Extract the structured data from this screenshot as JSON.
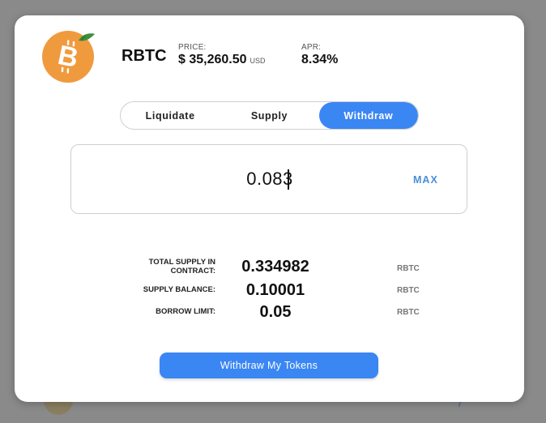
{
  "asset": {
    "symbol": "RBTC",
    "price_label": "PRICE:",
    "price_value": "$ 35,260.50",
    "price_unit": "USD",
    "apr_label": "APR:",
    "apr_value": "8.34%",
    "logo_icon": "bitcoin-orange-logo"
  },
  "tabs": [
    {
      "label": "Liquidate",
      "active": false
    },
    {
      "label": "Supply",
      "active": false
    },
    {
      "label": "Withdraw",
      "active": true
    }
  ],
  "amount": {
    "value": "0.083",
    "max_label": "MAX"
  },
  "stats": [
    {
      "label": "TOTAL SUPPLY IN CONTRACT:",
      "value": "0.334982",
      "unit": "RBTC"
    },
    {
      "label": "SUPPLY BALANCE:",
      "value": "0.10001",
      "unit": "RBTC"
    },
    {
      "label": "BORROW LIMIT:",
      "value": "0.05",
      "unit": "RBTC"
    }
  ],
  "action": {
    "label": "Withdraw My Tokens"
  },
  "colors": {
    "accent": "#3a86f3",
    "max_link": "#4a8fd6",
    "logo_orange": "#f09a3e",
    "leaf_green": "#3f8f3a"
  }
}
